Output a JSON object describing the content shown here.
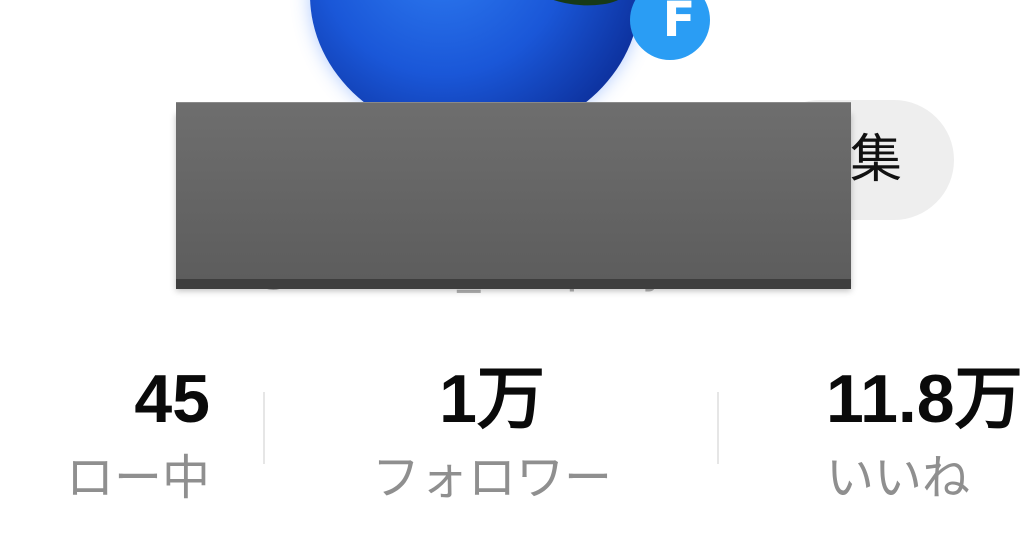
{
  "profile": {
    "edit_button_label": "集",
    "username": "@hisako_cosplay",
    "badge_glyph": "F"
  },
  "stats": [
    {
      "value": "45",
      "label": "ロー中"
    },
    {
      "value": "1万",
      "label": "フォロワー"
    },
    {
      "value": "11.8万",
      "label": "いいね"
    }
  ],
  "colors": {
    "badge": "#2a9df4",
    "label_gray": "#8f8f8f",
    "redaction": "#666666"
  }
}
